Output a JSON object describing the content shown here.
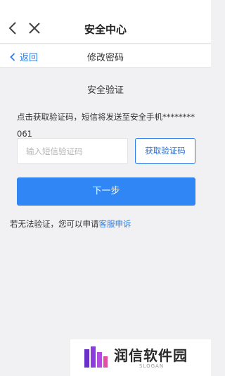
{
  "header": {
    "title": "安全中心"
  },
  "subheader": {
    "return_label": "返回",
    "title": "修改密码"
  },
  "verify": {
    "section_title": "安全验证",
    "notice": "点击获取验证码，短信将发送至安全手机********061",
    "input_placeholder": "输入短信验证码",
    "input_value": "",
    "get_code_label": "获取验证码",
    "next_label": "下一步",
    "fallback_text": "若无法验证，您可以申请",
    "fallback_link": "客服申诉"
  },
  "watermark": {
    "name": "润信软件园",
    "slogan": "SLOGAN"
  },
  "colors": {
    "accent": "#2f86f4",
    "link": "#2b7de9",
    "background": "#f1f1f3"
  },
  "icons": {
    "back": "chevron-left-icon",
    "close": "close-icon",
    "return": "chevron-left-icon"
  }
}
